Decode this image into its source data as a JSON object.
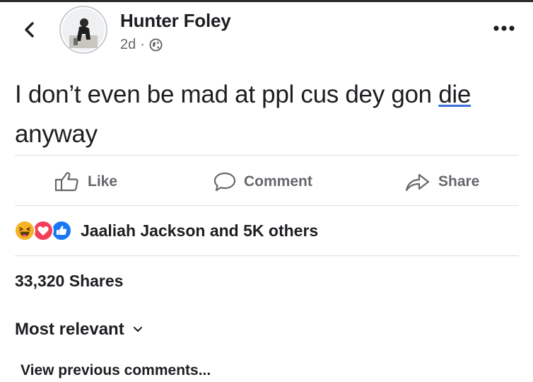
{
  "post": {
    "author": "Hunter Foley",
    "time": "2d",
    "separator": "·",
    "audience_icon": "globe-icon",
    "text_before": "I don’t even be mad at ppl cus dey gon ",
    "text_highlight": "die",
    "text_after": " anyway"
  },
  "actions": {
    "like": "Like",
    "comment": "Comment",
    "share": "Share"
  },
  "reactions": {
    "icons": [
      "haha-icon",
      "love-icon",
      "like-icon"
    ],
    "summary": "Jaaliah Jackson and 5K others"
  },
  "shares_count": "33,320 Shares",
  "comments": {
    "sort_label": "Most relevant",
    "view_previous": "View previous comments..."
  },
  "colors": {
    "text": "#1c1e21",
    "secondary": "#65676b",
    "like_blue": "#1877f2",
    "love_red": "#f33e58",
    "haha_yellow": "#f7b125",
    "highlight_underline": "#3b6fd6"
  }
}
